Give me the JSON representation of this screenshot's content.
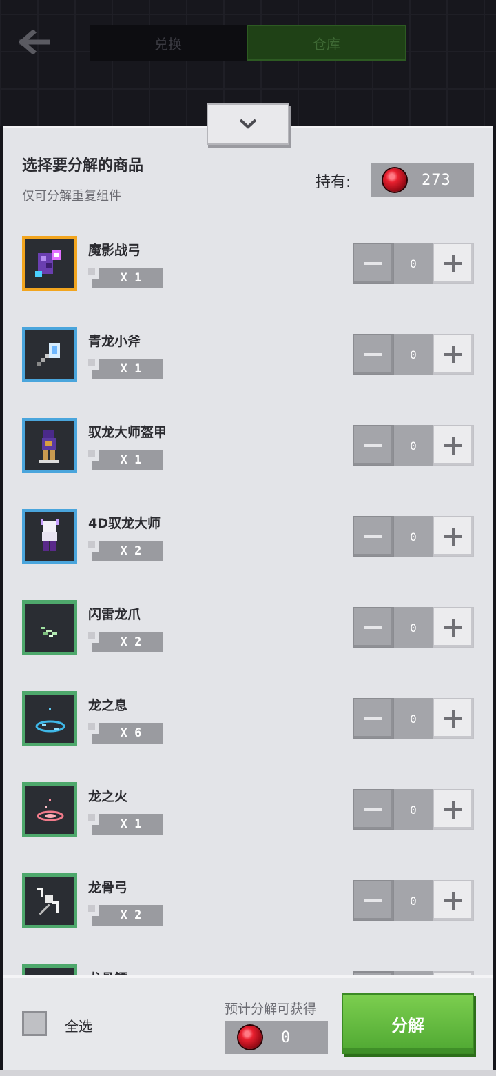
{
  "header": {
    "back_icon": "arrow-left-icon",
    "tabs": [
      {
        "label": "兑换",
        "active": false
      },
      {
        "label": "仓库",
        "active": true
      }
    ]
  },
  "panel": {
    "collapse_icon": "chevron-down-icon",
    "title": "选择要分解的商品",
    "subtitle": "仅可分解重复组件",
    "hold_label": "持有:",
    "hold_value": "273",
    "gem_icon": "red-gem-icon"
  },
  "items": [
    {
      "name": "魔影战弓",
      "qty": "X 1",
      "value": "0",
      "frame": "gold"
    },
    {
      "name": "青龙小斧",
      "qty": "X 1",
      "value": "0",
      "frame": "blue"
    },
    {
      "name": "驭龙大师盔甲",
      "qty": "X 1",
      "value": "0",
      "frame": "blue"
    },
    {
      "name": "4D驭龙大师",
      "qty": "X 2",
      "value": "0",
      "frame": "blue"
    },
    {
      "name": "闪雷龙爪",
      "qty": "X 2",
      "value": "0",
      "frame": "green"
    },
    {
      "name": "龙之息",
      "qty": "X 6",
      "value": "0",
      "frame": "green"
    },
    {
      "name": "龙之火",
      "qty": "X 1",
      "value": "0",
      "frame": "green"
    },
    {
      "name": "龙骨弓",
      "qty": "X 2",
      "value": "0",
      "frame": "green"
    },
    {
      "name": "龙骨镖",
      "qty": "",
      "value": "",
      "frame": "green"
    }
  ],
  "footer": {
    "select_all": "全选",
    "estimate_label": "预计分解可获得",
    "estimate_value": "0",
    "decompose_label": "分解"
  },
  "colors": {
    "frame_gold": "#f2a51f",
    "frame_blue": "#4aa5dc",
    "frame_green": "#4ea86c",
    "button_green": "#5bb83a"
  }
}
